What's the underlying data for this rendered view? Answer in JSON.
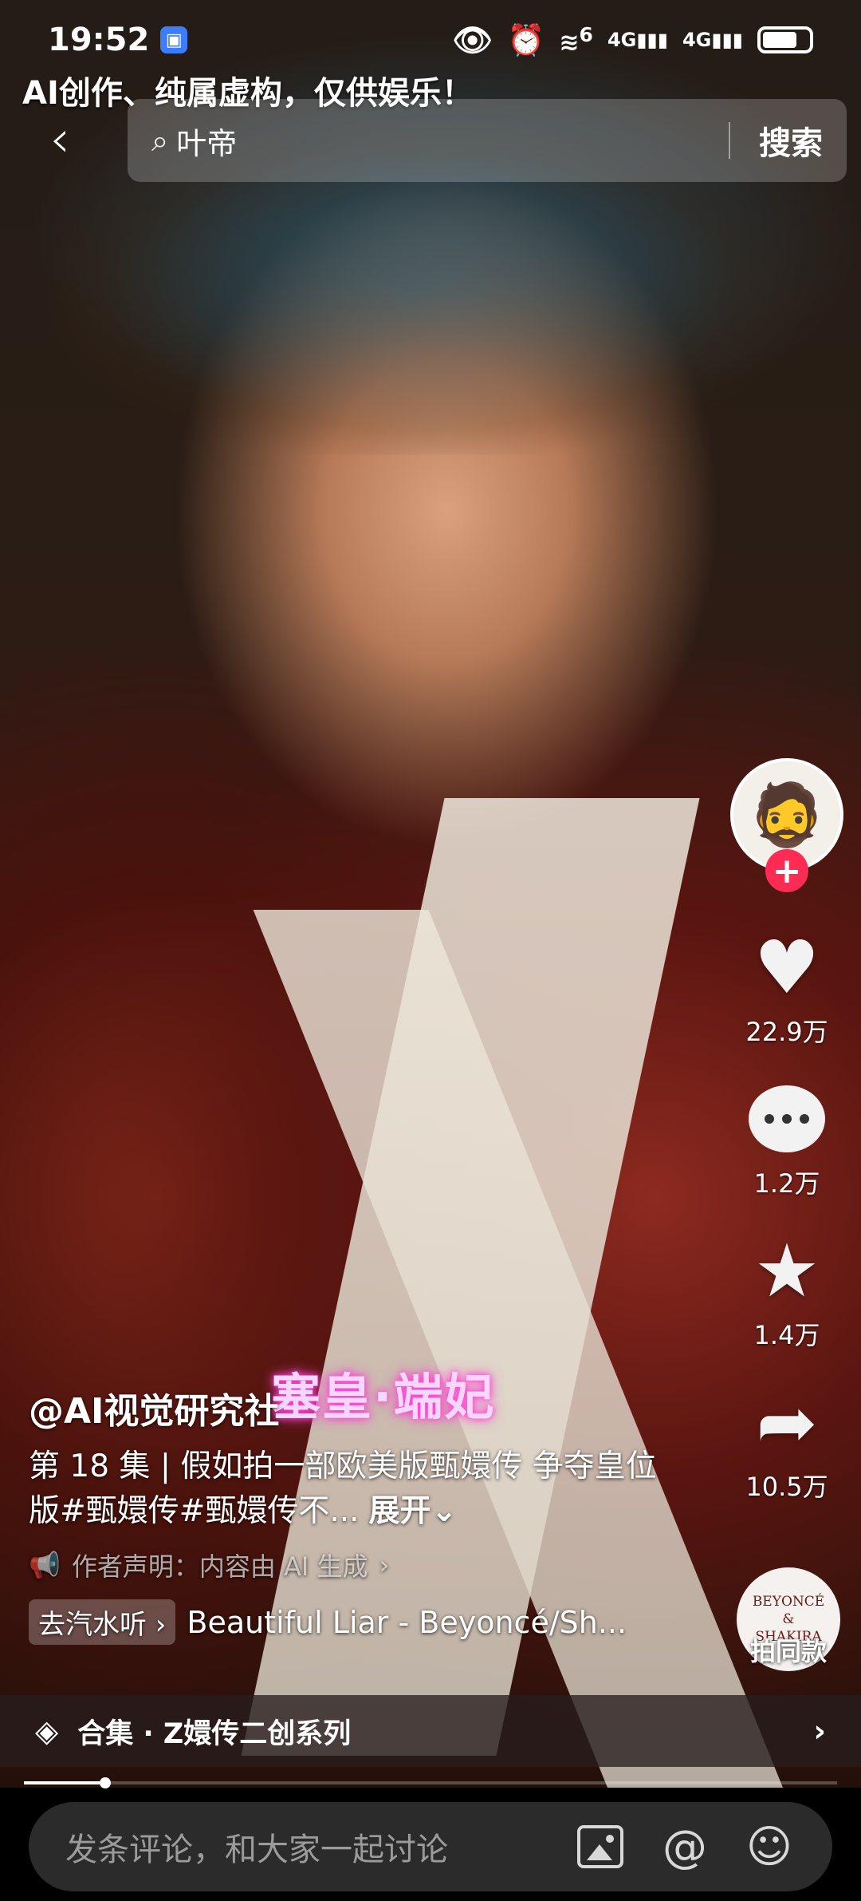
{
  "status_bar": {
    "time": "19:52",
    "network_label_1": "6",
    "network_label_2": "4G",
    "network_label_3": "4G"
  },
  "disclaimer": "AI创作、纯属虚构，仅供娱乐！",
  "search": {
    "value": "叶帝",
    "button_label": "搜索"
  },
  "video": {
    "overlay_title": "塞皇·端妃",
    "progress_fraction": 0.1
  },
  "right_rail": {
    "like_count": "22.9万",
    "comment_count": "1.2万",
    "favorite_count": "1.4万",
    "share_count": "10.5万",
    "music_disc_line1": "BEYONCÉ",
    "music_disc_line2": "&",
    "music_disc_line3": "SHAKIRA",
    "shoot_same_label": "拍同款"
  },
  "info": {
    "author": "@AI视觉研究社",
    "description": "第 18 集 | 假如拍一部欧美版甄嬛传 争夺皇位版#甄嬛传#甄嬛传不...",
    "expand_label": "展开",
    "declaration": "作者声明：内容由 AI 生成",
    "music_tag": "去汽水听",
    "music_title": "Beautiful Liar - Beyoncé/Sh..."
  },
  "collection": {
    "label": "合集 · Z嬛传二创系列"
  },
  "comment_bar": {
    "placeholder": "发条评论，和大家一起讨论"
  },
  "icons": [
    "back-icon",
    "search-icon",
    "heart-icon",
    "comment-icon",
    "star-icon",
    "share-icon",
    "layers-icon",
    "chevron-right-icon",
    "image-icon",
    "at-icon",
    "emoji-icon",
    "plus-icon"
  ]
}
